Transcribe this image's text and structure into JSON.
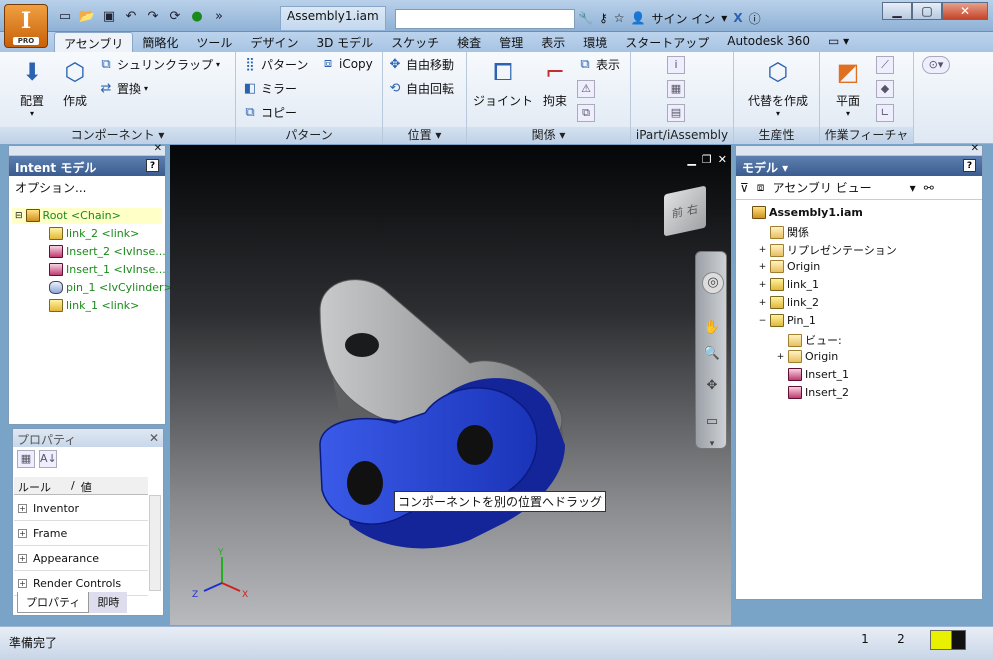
{
  "app": {
    "badge_letter": "I",
    "badge_sub": "PRO",
    "doc_tab": "Assembly1.iam",
    "help_signin": "サイン イン"
  },
  "window": {
    "minimize": "▁",
    "maximize": "▢",
    "close": "✕"
  },
  "ribbon_tabs": [
    "アセンブリ",
    "簡略化",
    "ツール",
    "デザイン",
    "3D モデル",
    "スケッチ",
    "検査",
    "管理",
    "表示",
    "環境",
    "スタートアップ",
    "Autodesk 360"
  ],
  "panels": {
    "component": {
      "title": "コンポーネント ▾",
      "place": "配置",
      "create": "作成",
      "shrinkwrap": "シュリンクラップ",
      "replace": "置換"
    },
    "pattern": {
      "title": "パターン",
      "pattern": "パターン",
      "icopy": "iCopy",
      "mirror": "ミラー",
      "copy": "コピー"
    },
    "position": {
      "title": "位置 ▾",
      "free_move": "自由移動",
      "free_rotate": "自由回転"
    },
    "relations": {
      "title": "関係 ▾",
      "joint": "ジョイント",
      "constrain": "拘束",
      "show": "表示"
    },
    "ipart": {
      "title": "iPart/iAssembly"
    },
    "productivity": {
      "title": "生産性",
      "substitute": "代替を作成"
    },
    "workfeatures": {
      "title": "作業フィーチャ",
      "plane": "平面"
    }
  },
  "intent_panel": {
    "title": "Intent モデル",
    "options": "オプション...",
    "items": [
      {
        "label": "Root <Chain>",
        "icon": "asm"
      },
      {
        "label": "link_2 <link>",
        "icon": "part"
      },
      {
        "label": "Insert_2 <IvInse...",
        "icon": "ins"
      },
      {
        "label": "Insert_1 <IvInse...",
        "icon": "ins"
      },
      {
        "label": "pin_1 <IvCylinder>",
        "icon": "pin"
      },
      {
        "label": "link_1 <link>",
        "icon": "part"
      }
    ]
  },
  "properties_panel": {
    "title": "プロパティ",
    "col_rule": "ルール",
    "col_sep": "/",
    "col_value": "値",
    "rows": [
      "Inventor",
      "Frame",
      "Appearance",
      "Render Controls"
    ],
    "tab_props": "プロパティ",
    "tab_immediate": "即時"
  },
  "viewport": {
    "tooltip": "コンポーネントを別の位置へドラッグ",
    "viewcube_front": "前",
    "viewcube_right": "右",
    "axis_x": "X",
    "axis_y": "Y",
    "axis_z": "Z"
  },
  "model_panel": {
    "title": "モデル ▾",
    "view_label": "アセンブリ ビュー",
    "items": [
      {
        "label": "Assembly1.iam",
        "icon": "asm",
        "depth": 0,
        "expander": ""
      },
      {
        "label": "関係",
        "icon": "folder",
        "depth": 1,
        "expander": ""
      },
      {
        "label": "リプレゼンテーション",
        "icon": "folder",
        "depth": 1,
        "expander": "+"
      },
      {
        "label": "Origin",
        "icon": "folder",
        "depth": 1,
        "expander": "+"
      },
      {
        "label": "link_1",
        "icon": "part",
        "depth": 1,
        "expander": "+"
      },
      {
        "label": "link_2",
        "icon": "part",
        "depth": 1,
        "expander": "+"
      },
      {
        "label": "Pin_1",
        "icon": "part",
        "depth": 1,
        "expander": "−"
      },
      {
        "label": "ビュー:",
        "icon": "view",
        "depth": 2,
        "expander": ""
      },
      {
        "label": "Origin",
        "icon": "folder",
        "depth": 2,
        "expander": "+"
      },
      {
        "label": "Insert_1",
        "icon": "ins",
        "depth": 2,
        "expander": ""
      },
      {
        "label": "Insert_2",
        "icon": "ins",
        "depth": 2,
        "expander": ""
      }
    ]
  },
  "status": {
    "text": "準備完了",
    "num1": "1",
    "num2": "2"
  },
  "colors": {
    "selection_blue": "#2c4fd6",
    "link_gray": "#9a9b9d",
    "accent": "#3a5c8f"
  }
}
